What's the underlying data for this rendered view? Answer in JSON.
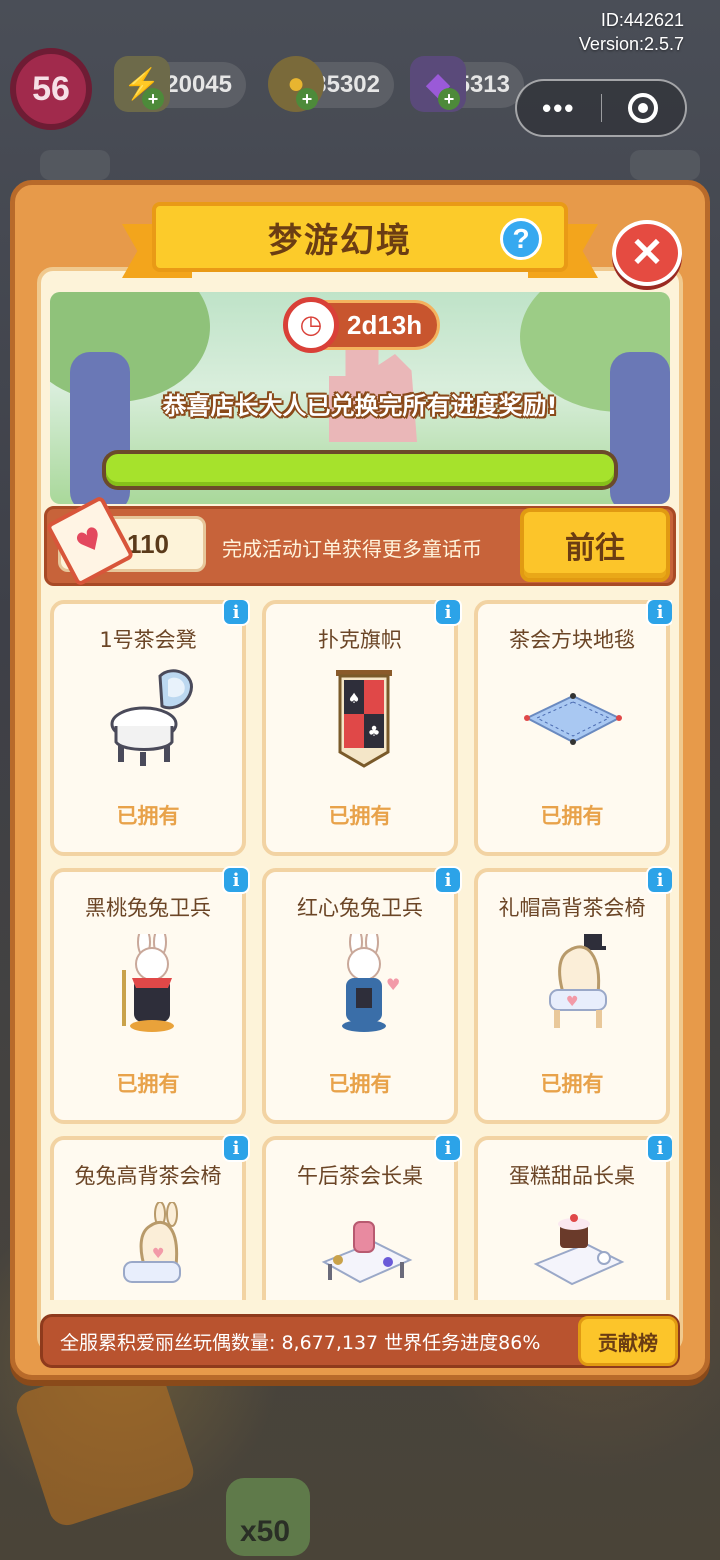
{
  "hud": {
    "id_text": "ID:442621",
    "version_text": "Version:2.5.7",
    "level": "56",
    "resources": [
      {
        "icon": "lightning-icon",
        "value": "20045",
        "color": "#f2c12e"
      },
      {
        "icon": "coin-icon",
        "value": "35302",
        "color": "#e8b530"
      },
      {
        "icon": "gem-icon",
        "value": "5313",
        "color": "#9a5ad8"
      }
    ],
    "capsule": {
      "more_label": "•••",
      "close_icon": "target-icon"
    }
  },
  "dialog": {
    "title": "梦游幻境",
    "help_icon": "?",
    "close_icon": "✕",
    "timer": "2d13h",
    "banner_message": "恭喜店长大人已兑换完所有进度奖励!",
    "progress_fraction": 1.0,
    "currency_value": "110",
    "currency_hint": "完成活动订单获得更多童话币",
    "go_button": "前往",
    "items": [
      {
        "name": "1号茶会凳",
        "status": "已拥有"
      },
      {
        "name": "扑克旗帜",
        "status": "已拥有"
      },
      {
        "name": "茶会方块地毯",
        "status": "已拥有"
      },
      {
        "name": "黑桃兔兔卫兵",
        "status": "已拥有"
      },
      {
        "name": "红心兔兔卫兵",
        "status": "已拥有"
      },
      {
        "name": "礼帽高背茶会椅",
        "status": "已拥有"
      },
      {
        "name": "兔兔高背茶会椅",
        "status": ""
      },
      {
        "name": "午后茶会长桌",
        "status": ""
      },
      {
        "name": "蛋糕甜品长桌",
        "status": ""
      }
    ],
    "footer_text": "全服累积爱丽丝玩偶数量: 8,677,137  世界任务进度86%",
    "rank_button": "贡献榜"
  },
  "background": {
    "clover_count": "x50"
  },
  "colors": {
    "panel": "#e79a4a",
    "accent_yellow": "#fcc52a",
    "progress_green": "#a6e22c",
    "owned_text": "#e8a24a"
  }
}
